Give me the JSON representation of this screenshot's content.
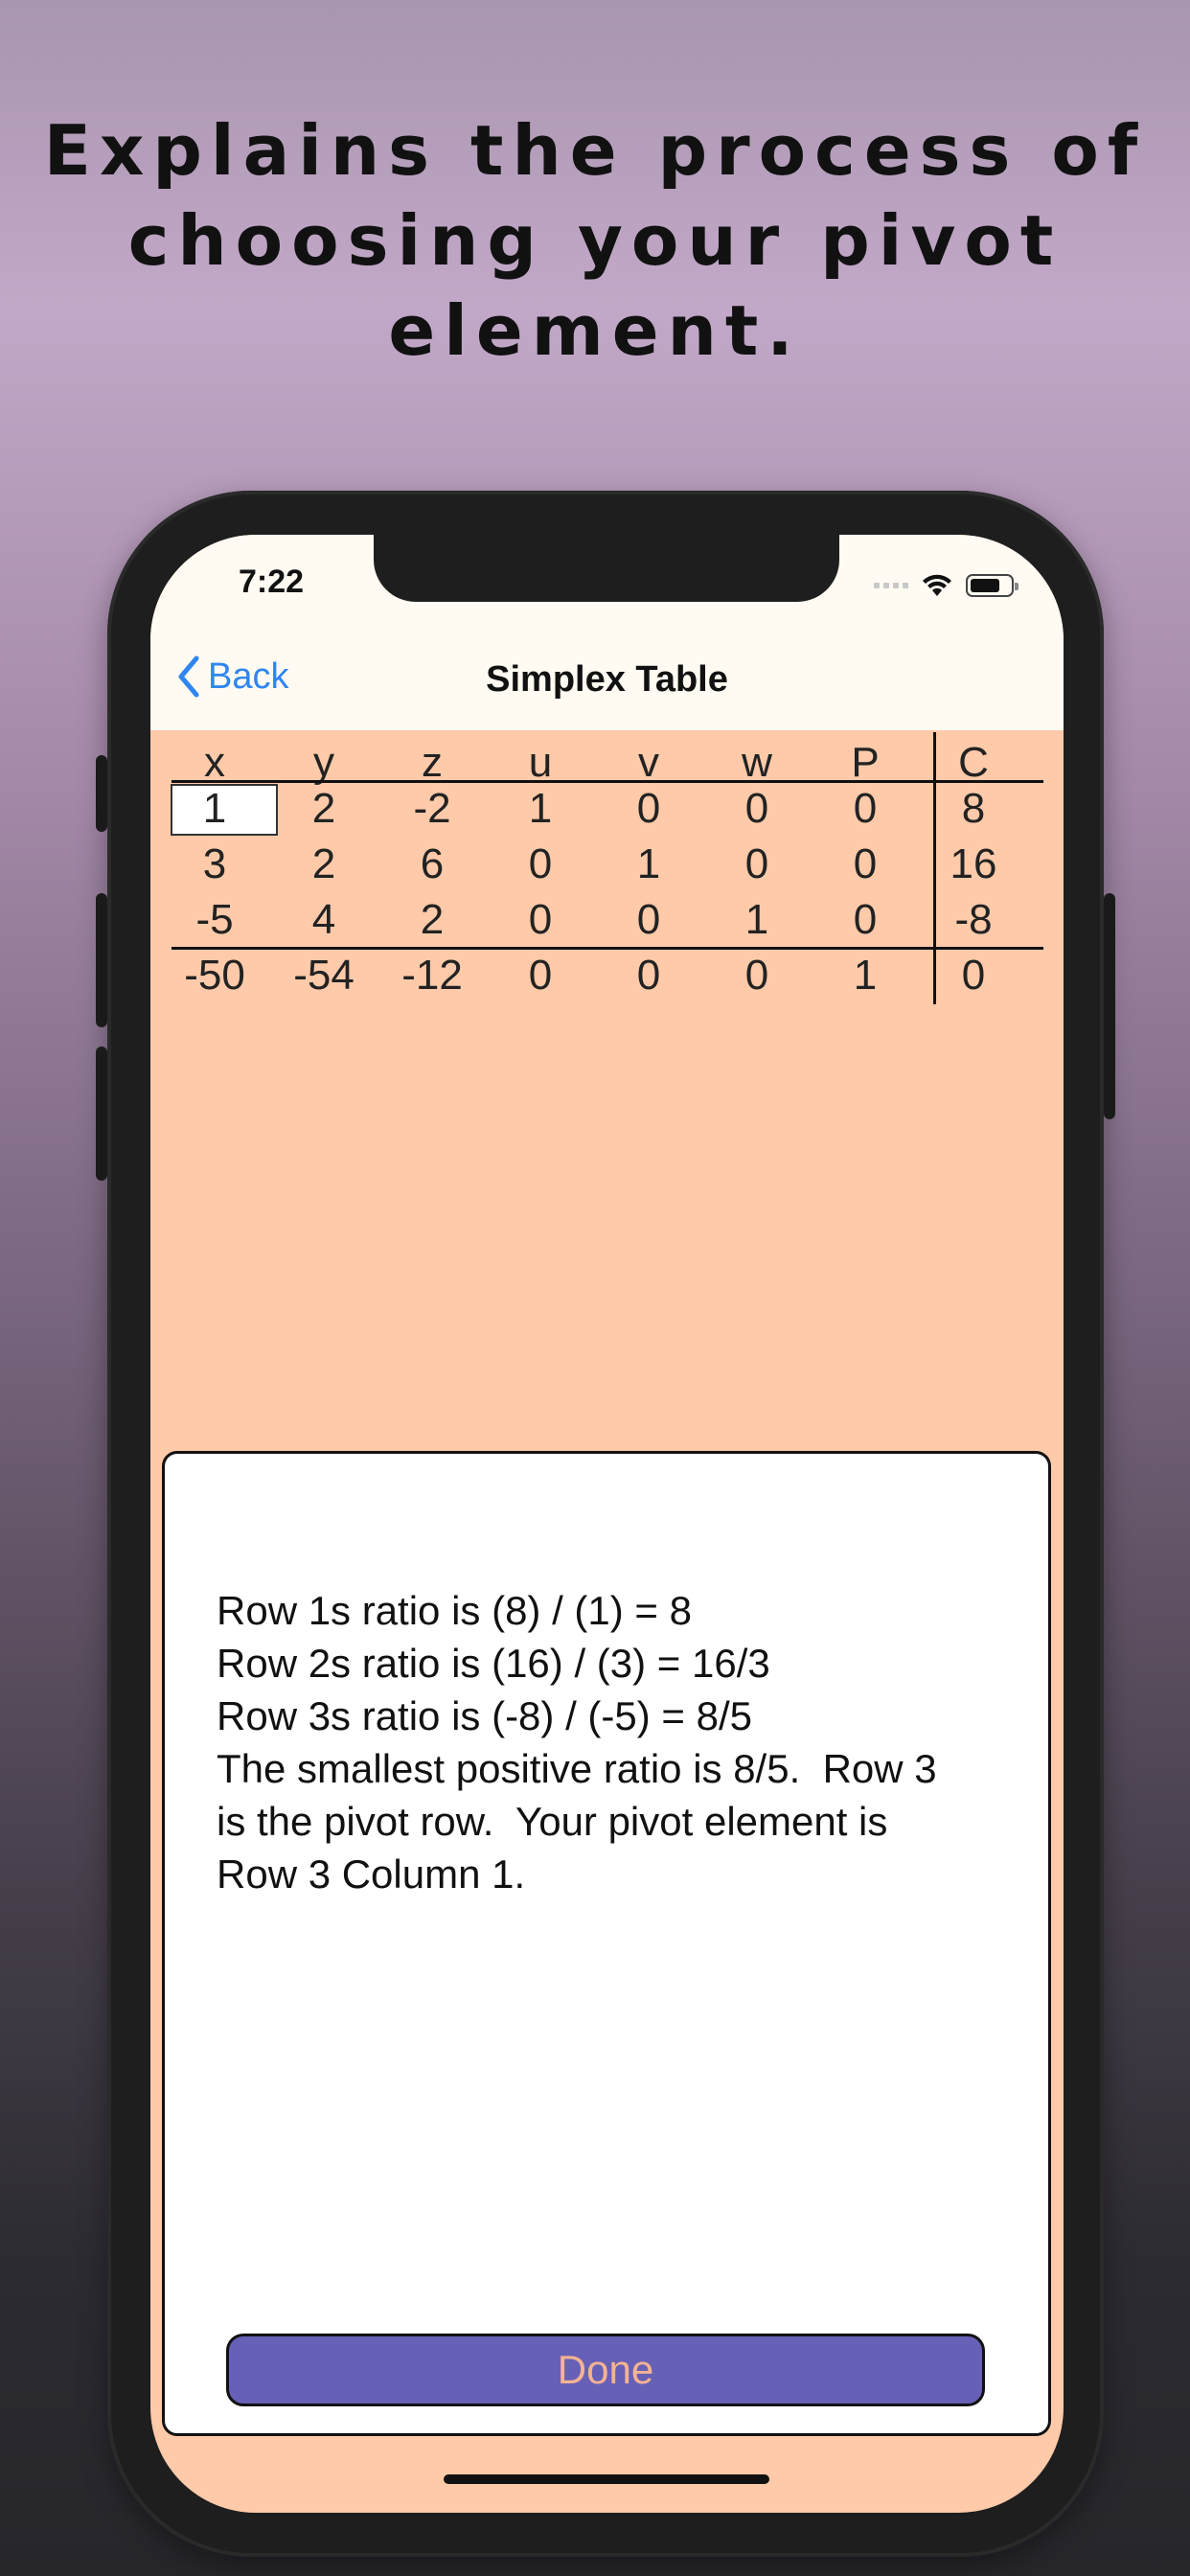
{
  "headline": {
    "line1": "Explains the process of",
    "line2": "choosing your pivot element."
  },
  "status_bar": {
    "time": "7:22",
    "icons": [
      "cellular-signal-icon",
      "wifi-icon",
      "battery-icon"
    ]
  },
  "nav": {
    "back_label": "Back",
    "title": "Simplex Table"
  },
  "table": {
    "headers": [
      "x",
      "y",
      "z",
      "u",
      "v",
      "w",
      "P",
      "C"
    ],
    "rows": [
      [
        "1",
        "2",
        "-2",
        "1",
        "0",
        "0",
        "0",
        "8"
      ],
      [
        "3",
        "2",
        "6",
        "0",
        "1",
        "0",
        "0",
        "16"
      ],
      [
        "-5",
        "4",
        "2",
        "0",
        "0",
        "1",
        "0",
        "-8"
      ],
      [
        "-50",
        "-54",
        "-12",
        "0",
        "0",
        "0",
        "1",
        "0"
      ]
    ],
    "selected_cell": {
      "row": 1,
      "column": 1
    }
  },
  "modal": {
    "lines": [
      "Row 1s ratio is (8) / (1) = 8",
      "Row 2s ratio is (16) / (3) = 16/3",
      "Row 3s ratio is (-8) / (-5) = 8/5",
      "The smallest positive ratio is 8/5.  Row 3",
      "is the pivot row.  Your pivot element is",
      "Row 3 Column 1."
    ],
    "done_label": "Done"
  },
  "colors": {
    "accent_blue": "#2f86f0",
    "screen_background": "#fecaa9",
    "done_button": "#6760b7",
    "done_text": "#f4b393"
  }
}
